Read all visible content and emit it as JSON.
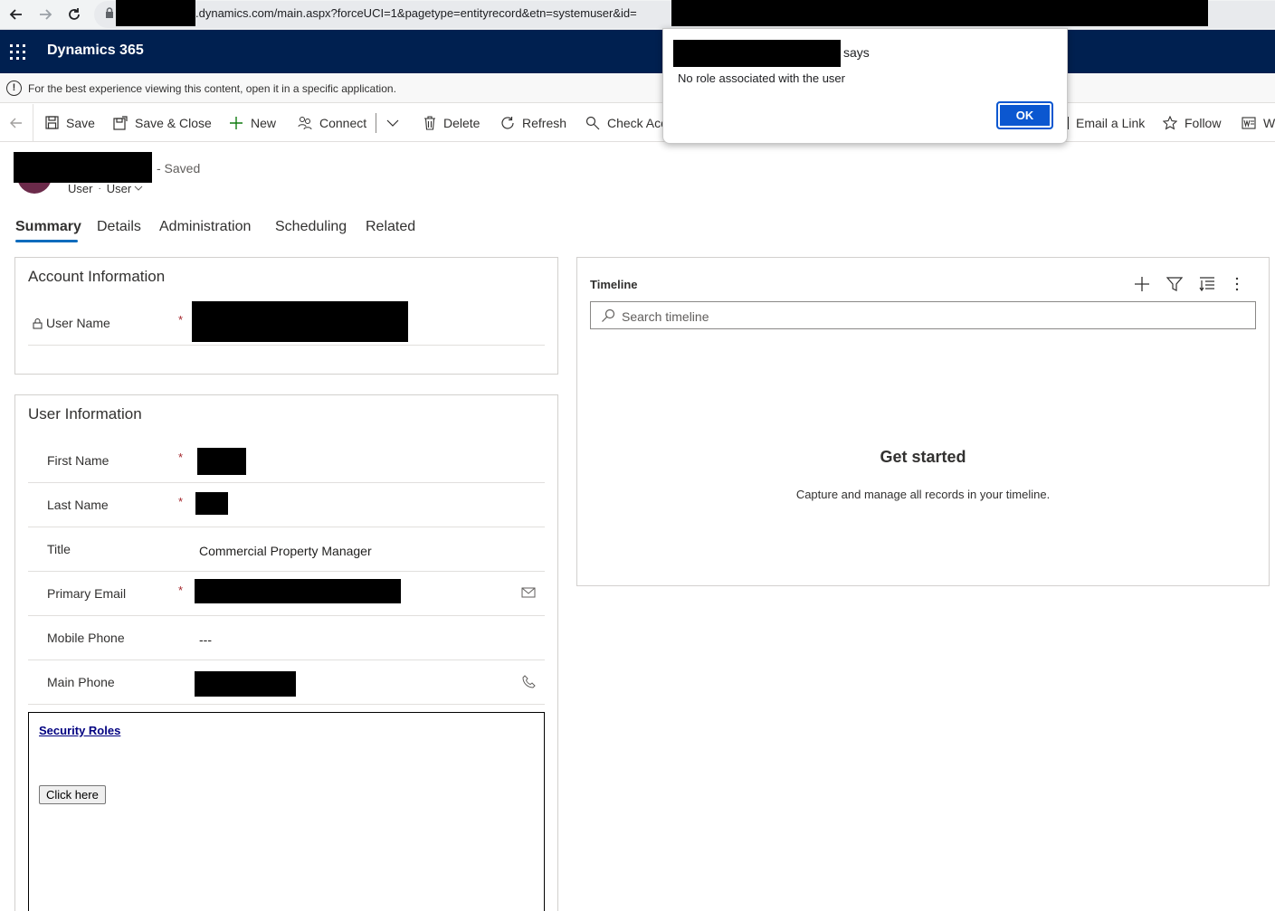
{
  "browser": {
    "url_visible": ".dynamics.com/main.aspx?forceUCI=1&pagetype=entityrecord&etn=systemuser&id="
  },
  "app": {
    "name": "Dynamics 365"
  },
  "infobar": {
    "text": "For the best experience viewing this content, open it in a specific application."
  },
  "commands": {
    "save": "Save",
    "save_close": "Save & Close",
    "new": "New",
    "connect": "Connect",
    "delete": "Delete",
    "refresh": "Refresh",
    "check_access": "Check Acc",
    "email_link": "Email a Link",
    "follow": "Follow",
    "word": "W"
  },
  "record": {
    "status": "- Saved",
    "entity": "User",
    "form": "User"
  },
  "tabs": [
    "Summary",
    "Details",
    "Administration",
    "Scheduling",
    "Related"
  ],
  "account_section": {
    "title": "Account Information",
    "user_name_label": "User Name",
    "required_mark": "*"
  },
  "user_section": {
    "title": "User Information",
    "first_name_label": "First Name",
    "last_name_label": "Last Name",
    "title_label": "Title",
    "title_value": "Commercial Property Manager",
    "email_label": "Primary Email",
    "mobile_label": "Mobile Phone",
    "mobile_value": "---",
    "main_phone_label": "Main Phone",
    "required_mark": "*"
  },
  "security": {
    "link": "Security Roles",
    "button": "Click here"
  },
  "timeline": {
    "title": "Timeline",
    "search_placeholder": "Search timeline",
    "empty_title": "Get started",
    "empty_desc": "Capture and manage all records in your timeline."
  },
  "dialog": {
    "says": "says",
    "message": "No role associated with the user",
    "ok": "OK"
  },
  "colors": {
    "appbar": "#002050",
    "accent": "#0f6cbd",
    "required": "#a4262c",
    "ok_button": "#0b57d0"
  }
}
